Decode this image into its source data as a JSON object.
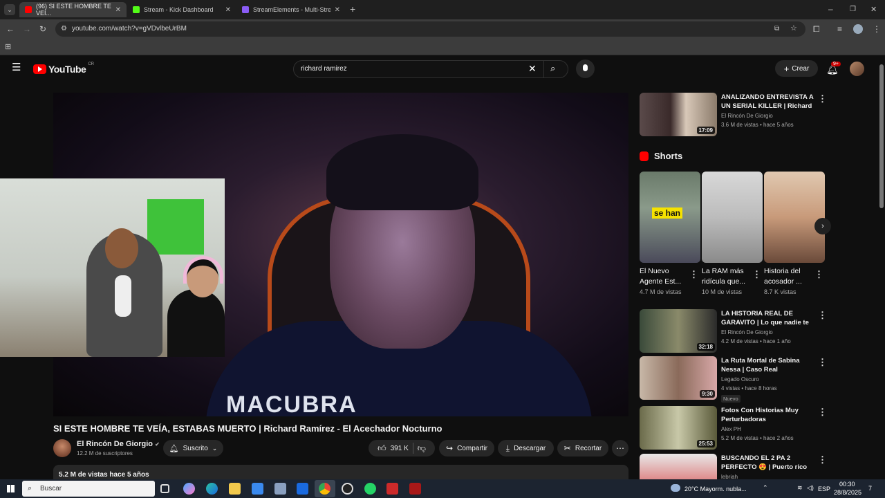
{
  "browser": {
    "tabs": [
      {
        "label": "(96) SI ESTE HOMBRE TE VEÍ...",
        "active": true,
        "favicon_color": "#ff0000"
      },
      {
        "label": "Stream - Kick Dashboard",
        "active": false,
        "favicon_color": "#53fc18"
      },
      {
        "label": "StreamElements - Multi-Stream...",
        "active": false,
        "favicon_color": "#8a5cf6"
      }
    ],
    "url": "youtube.com/watch?v=gVDvlbeUrBM"
  },
  "youtube": {
    "logo_text": "YouTube",
    "region": "CR",
    "search_value": "richard ramirez",
    "create_label": "Crear",
    "notif_count": "9+"
  },
  "video": {
    "shirt_text": "MACUBRA",
    "title": "SI ESTE HOMBRE TE VEÍA, ESTABAS MUERTO | Richard Ramírez - El Acechador Nocturno",
    "channel": "El Rincón De Giorgio",
    "subscribers": "12.2 M de suscriptores",
    "subscribe_label": "Suscrito",
    "likes": "391 K",
    "share_label": "Compartir",
    "download_label": "Descargar",
    "clip_label": "Recortar",
    "description_meta": "5.2 M de vistas  hace 5 años"
  },
  "sidebar": {
    "top_video": {
      "title": "ANALIZANDO ENTREVISTA A UN SERIAL KILLER | Richard ...",
      "channel": "El Rincón De Giorgio",
      "meta": "3.6 M de vistas • hace 5 años",
      "duration": "17:09"
    },
    "shorts_heading": "Shorts",
    "shorts": [
      {
        "title": "El Nuevo Agente Est...",
        "views": "4.7 M de vistas",
        "overlay": "se han"
      },
      {
        "title": "La RAM más ridícula que...",
        "views": "10 M de vistas",
        "overlay": ""
      },
      {
        "title": "Historia del acosador ...",
        "views": "8.7 K vistas",
        "overlay": ""
      }
    ],
    "videos": [
      {
        "title": "LA HISTORIA REAL DE GARAVITO | Lo que nadie te h...",
        "channel": "El Rincón De Giorgio",
        "meta": "4.2 M de vistas • hace 1 año",
        "duration": "32:18",
        "badge": ""
      },
      {
        "title": "La Ruta Mortal de Sabina Nessa | Caso Real",
        "channel": "Legado Oscuro",
        "meta": "4 vistas • hace 8 horas",
        "duration": "9:30",
        "badge": "Nuevo"
      },
      {
        "title": "Fotos Con Historias Muy Perturbadoras",
        "channel": "Alex PH",
        "meta": "5.2 M de vistas • hace 2 años",
        "duration": "25:53",
        "badge": ""
      },
      {
        "title": "BUSCANDO EL 2 PA 2 PERFECTO 😍 | Puerto rico PR",
        "channel": "lebriah",
        "meta": "",
        "duration": "",
        "badge": ""
      }
    ]
  },
  "taskbar": {
    "search_label": "Buscar",
    "weather": "20°C  Mayorm. nubla...",
    "lang": "ESP",
    "time": "00:30",
    "date": "28/8/2025",
    "notif": "7"
  }
}
